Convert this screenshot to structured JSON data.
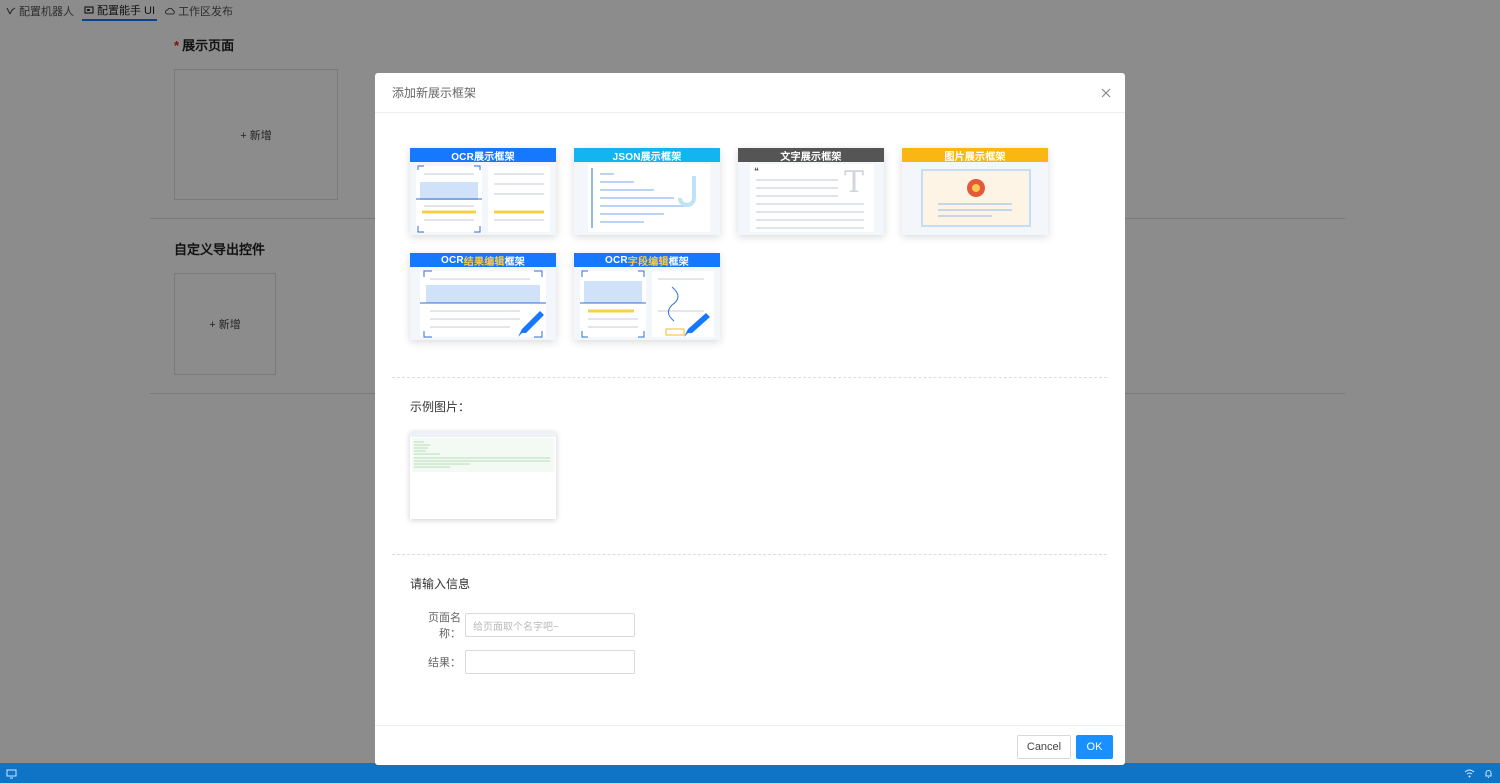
{
  "topnav": {
    "tabs": [
      {
        "label": "配置机器人",
        "icon": "robot-icon"
      },
      {
        "label": "配置能手 UI",
        "icon": "ui-icon"
      },
      {
        "label": "工作区发布",
        "icon": "cloud-icon"
      }
    ]
  },
  "background": {
    "section1_required": "*",
    "section1_title": "展示页面",
    "section1_add": "+ 新增",
    "section2_title": "自定义导出控件",
    "section2_add": "+ 新增"
  },
  "modal": {
    "title": "添加新展示框架",
    "close_icon": "close-icon",
    "frames": [
      {
        "label": "OCR展示框架",
        "color": "#1677ff"
      },
      {
        "label": "JSON展示框架",
        "color": "#13b5f0"
      },
      {
        "label": "文字展示框架",
        "color": "#555555"
      },
      {
        "label": "图片展示框架",
        "color": "#fab714"
      },
      {
        "label_a": "OCR",
        "label_b": "结果编辑",
        "label_c": "框架",
        "color": "#1677ff"
      },
      {
        "label_a": "OCR",
        "label_b": "字段编辑",
        "label_c": "框架",
        "color": "#1677ff"
      }
    ],
    "sample_label": "示例图片：",
    "info_label": "请输入信息",
    "fields": {
      "page_name_label": "页面名称：",
      "page_name_placeholder": "给页面取个名字吧~",
      "result_label": "结果：",
      "result_value": ""
    },
    "buttons": {
      "cancel": "Cancel",
      "ok": "OK"
    }
  },
  "colors": {
    "accent": "#1890ff",
    "statusbar": "#0f74c5",
    "highlight": "#ffc93c"
  }
}
